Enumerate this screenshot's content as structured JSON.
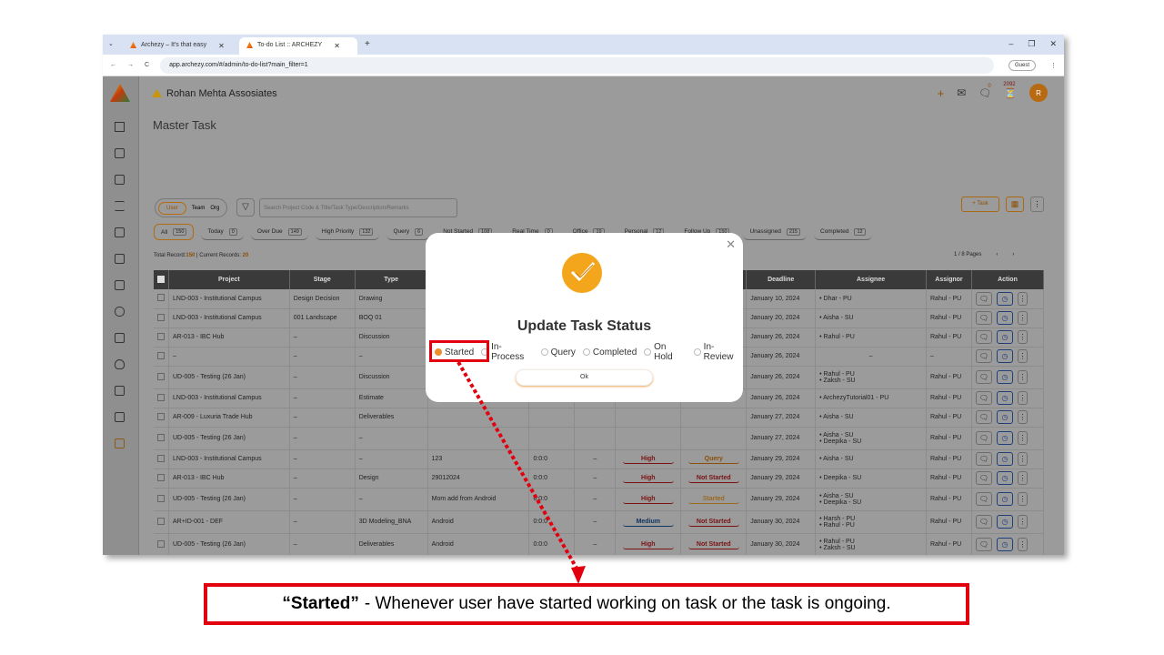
{
  "browser": {
    "tabs": [
      {
        "label": "Archezy – It's that easy"
      },
      {
        "label": "To-do List :: ARCHEZY"
      }
    ],
    "url": "app.archezy.com/#/admin/to-do-list?main_filter=1",
    "profile": "Guest"
  },
  "header": {
    "company": "Rohan Mehta Assosiates",
    "count": "2092",
    "notif_count": "0",
    "avatar": "R"
  },
  "page": {
    "title": "Master Task",
    "toggle": {
      "user": "User",
      "team": "Team",
      "org": "Org"
    },
    "search_placeholder": "Search Project Code & Title/Task Type/Description/Remarks",
    "task_button": "+ Task",
    "records_prefix": "Total Record:",
    "records_total": "150",
    "records_mid": " | Current Records: ",
    "records_current": "20",
    "pages": "1 / 8 Pages"
  },
  "filters": [
    {
      "label": "All",
      "count": "150"
    },
    {
      "label": "Today",
      "count": "0"
    },
    {
      "label": "Over Due",
      "count": "149"
    },
    {
      "label": "High Priority",
      "count": "132"
    },
    {
      "label": "Query",
      "count": "6"
    },
    {
      "label": "Not Started",
      "count": "108"
    },
    {
      "label": "Real Time",
      "count": "0"
    },
    {
      "label": "Office",
      "count": "19"
    },
    {
      "label": "Personal",
      "count": "12"
    },
    {
      "label": "Follow Up",
      "count": "150"
    },
    {
      "label": "Unassigned",
      "count": "215"
    },
    {
      "label": "Completed",
      "count": "12"
    }
  ],
  "table": {
    "headers": [
      "Project",
      "Stage",
      "Type",
      "",
      "",
      "",
      "",
      "",
      "Deadline",
      "Assignee",
      "Assignor",
      "Action"
    ],
    "rows": [
      {
        "project": "LND-003 - Institutional Campus",
        "stage": "Design Decision",
        "type": "Drawing",
        "desc": "",
        "time": "",
        "dash": "",
        "priority": "",
        "status": "",
        "deadline": "January 10, 2024",
        "assignee": [
          "Dhar - PU"
        ],
        "assignor": "Rahul - PU"
      },
      {
        "project": "LND-003 - Institutional Campus",
        "stage": "001 Landscape",
        "type": "BOQ 01",
        "desc": "",
        "time": "",
        "dash": "",
        "priority": "",
        "status": "",
        "deadline": "January 20, 2024",
        "assignee": [
          "Aisha - SU"
        ],
        "assignor": "Rahul - PU"
      },
      {
        "project": "AR-013 - IBC Hub",
        "stage": "–",
        "type": "Discussion",
        "desc": "",
        "time": "",
        "dash": "",
        "priority": "",
        "status": "",
        "deadline": "January 26, 2024",
        "assignee": [
          "Rahul - PU"
        ],
        "assignor": "Rahul - PU"
      },
      {
        "project": "–",
        "stage": "–",
        "type": "–",
        "desc": "",
        "time": "",
        "dash": "",
        "priority": "",
        "status": "",
        "deadline": "January 26, 2024",
        "assignee_center": "–",
        "assignor": "–"
      },
      {
        "project": "UD-005 - Testing (26 Jan)",
        "stage": "–",
        "type": "Discussion",
        "desc": "",
        "time": "",
        "dash": "",
        "priority": "",
        "status": "",
        "deadline": "January 26, 2024",
        "assignee": [
          "Rahul - PU",
          "Zaksh - SU"
        ],
        "assignor": "Rahul - PU"
      },
      {
        "project": "LND-003 - Institutional Campus",
        "stage": "–",
        "type": "Estimate",
        "desc": "",
        "time": "",
        "dash": "",
        "priority": "",
        "status": "",
        "deadline": "January 26, 2024",
        "assignee": [
          "ArchezyTutorial01 - PU"
        ],
        "assignor": "Rahul - PU"
      },
      {
        "project": "AR-009 - Luxuria Trade Hub",
        "stage": "–",
        "type": "Deliverables",
        "desc": "",
        "time": "",
        "dash": "",
        "priority": "",
        "status": "",
        "deadline": "January 27, 2024",
        "assignee": [
          "Aisha - SU"
        ],
        "assignor": "Rahul - PU"
      },
      {
        "project": "UD-005 - Testing (26 Jan)",
        "stage": "–",
        "type": "–",
        "desc": "",
        "time": "",
        "dash": "",
        "priority": "",
        "status": "",
        "deadline": "January 27, 2024",
        "assignee": [
          "Aisha - SU",
          "Deepika - SU"
        ],
        "assignor": "Rahul - PU"
      },
      {
        "project": "LND-003 - Institutional Campus",
        "stage": "–",
        "type": "–",
        "desc": "123",
        "time": "0:0:0",
        "dash": "–",
        "priority": "High",
        "status": "Query",
        "deadline": "January 29, 2024",
        "assignee": [
          "Aisha - SU"
        ],
        "assignor": "Rahul - PU"
      },
      {
        "project": "AR-013 - IBC Hub",
        "stage": "–",
        "type": "Design",
        "desc": "29012024",
        "time": "0:0:0",
        "dash": "–",
        "priority": "High",
        "status": "Not Started",
        "deadline": "January 29, 2024",
        "assignee": [
          "Deepika - SU"
        ],
        "assignor": "Rahul - PU"
      },
      {
        "project": "UD-005 - Testing (26 Jan)",
        "stage": "–",
        "type": "–",
        "desc": "Mom add from Android",
        "time": "0:0:0",
        "dash": "–",
        "priority": "High",
        "status": "Started",
        "deadline": "January 29, 2024",
        "assignee": [
          "Aisha - SU",
          "Deepika - SU"
        ],
        "assignor": "Rahul - PU"
      },
      {
        "project": "AR+ID-001 - DEF",
        "stage": "–",
        "type": "3D Modeling_BNA",
        "desc": "Android",
        "time": "0:0:0",
        "dash": "–",
        "priority": "Medium",
        "status": "Not Started",
        "deadline": "January 30, 2024",
        "assignee": [
          "Harsh - PU",
          "Rahul - PU"
        ],
        "assignor": "Rahul - PU"
      },
      {
        "project": "UD-005 - Testing (26 Jan)",
        "stage": "–",
        "type": "Deliverables",
        "desc": "Android",
        "time": "0:0:0",
        "dash": "–",
        "priority": "High",
        "status": "Not Started",
        "deadline": "January 30, 2024",
        "assignee": [
          "Rahul - PU",
          "Zaksh - SU"
        ],
        "assignor": "Rahul - PU"
      }
    ]
  },
  "modal": {
    "title": "Update Task Status",
    "options": [
      "Started",
      "In-Process",
      "Query",
      "Completed",
      "On Hold",
      "In-Review"
    ],
    "selected": "Started",
    "ok": "Ok"
  },
  "callout": {
    "bold": "“Started”",
    "text": "- Whenever user have started working on task or the task is ongoing."
  },
  "colors": {
    "accent": "#f3a51c",
    "highlight": "#e2000f"
  }
}
